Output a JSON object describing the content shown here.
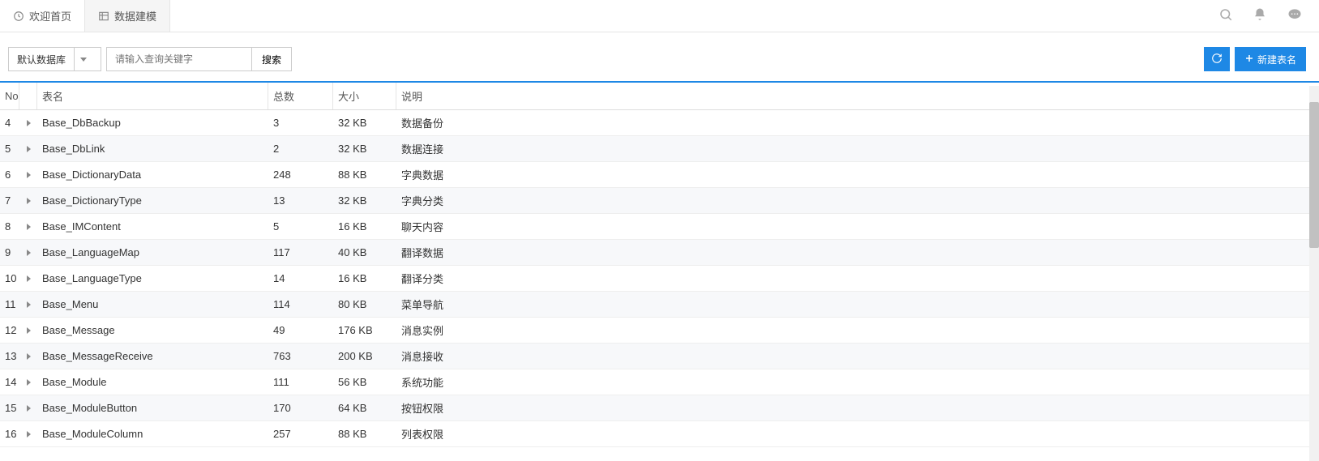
{
  "tabs": [
    {
      "label": "欢迎首页",
      "active": false,
      "icon": "dashboard"
    },
    {
      "label": "数据建模",
      "active": true,
      "icon": "table"
    }
  ],
  "toolbar": {
    "db_select_label": "默认数据库",
    "search_placeholder": "请输入查询关键字",
    "search_btn_label": "搜索",
    "new_table_label": "新建表名"
  },
  "columns": {
    "no": "No",
    "name": "表名",
    "total": "总数",
    "size": "大小",
    "desc": "说明"
  },
  "rows": [
    {
      "no": "4",
      "name": "Base_DbBackup",
      "total": "3",
      "size": "32 KB",
      "desc": "数据备份"
    },
    {
      "no": "5",
      "name": "Base_DbLink",
      "total": "2",
      "size": "32 KB",
      "desc": "数据连接"
    },
    {
      "no": "6",
      "name": "Base_DictionaryData",
      "total": "248",
      "size": "88 KB",
      "desc": "字典数据"
    },
    {
      "no": "7",
      "name": "Base_DictionaryType",
      "total": "13",
      "size": "32 KB",
      "desc": "字典分类"
    },
    {
      "no": "8",
      "name": "Base_IMContent",
      "total": "5",
      "size": "16 KB",
      "desc": "聊天内容"
    },
    {
      "no": "9",
      "name": "Base_LanguageMap",
      "total": "117",
      "size": "40 KB",
      "desc": "翻译数据"
    },
    {
      "no": "10",
      "name": "Base_LanguageType",
      "total": "14",
      "size": "16 KB",
      "desc": "翻译分类"
    },
    {
      "no": "11",
      "name": "Base_Menu",
      "total": "114",
      "size": "80 KB",
      "desc": "菜单导航"
    },
    {
      "no": "12",
      "name": "Base_Message",
      "total": "49",
      "size": "176 KB",
      "desc": "消息实例"
    },
    {
      "no": "13",
      "name": "Base_MessageReceive",
      "total": "763",
      "size": "200 KB",
      "desc": "消息接收"
    },
    {
      "no": "14",
      "name": "Base_Module",
      "total": "111",
      "size": "56 KB",
      "desc": "系统功能"
    },
    {
      "no": "15",
      "name": "Base_ModuleButton",
      "total": "170",
      "size": "64 KB",
      "desc": "按钮权限"
    },
    {
      "no": "16",
      "name": "Base_ModuleColumn",
      "total": "257",
      "size": "88 KB",
      "desc": "列表权限"
    }
  ]
}
